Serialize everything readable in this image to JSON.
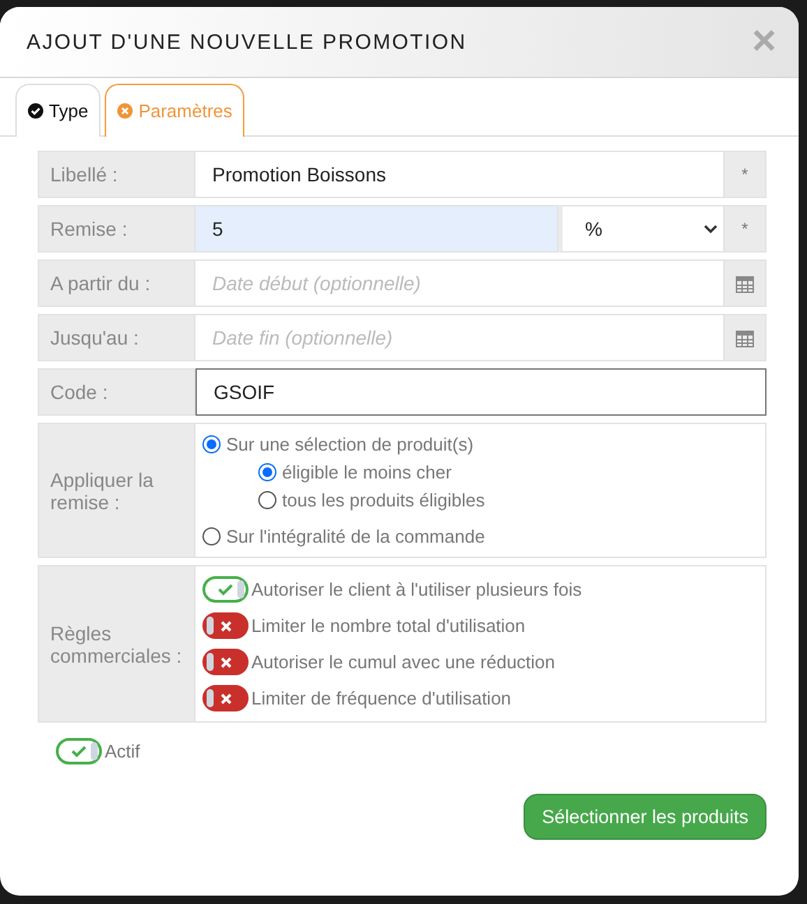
{
  "dialog": {
    "title": "AJOUT D'UNE NOUVELLE PROMOTION",
    "close": "×"
  },
  "tabs": [
    {
      "label": "Type",
      "kind": "done",
      "selected": false
    },
    {
      "label": "Paramètres",
      "kind": "error",
      "selected": true
    }
  ],
  "fields": [
    {
      "label": "Libellé :",
      "kind": "text",
      "value": "Promotion Boissons",
      "required": "*"
    },
    {
      "label": "Remise :",
      "kind": "amount",
      "value": "5",
      "unit": "%",
      "highlighted": true,
      "required": "*"
    },
    {
      "label": "A partir du :",
      "kind": "date",
      "placeholder": "Date début (optionnelle)"
    },
    {
      "label": "Jusqu'au :",
      "kind": "date",
      "placeholder": "Date fin (optionnelle)"
    },
    {
      "label": "Code :",
      "kind": "text",
      "value": "GSOIF",
      "focused": true
    }
  ],
  "apply": {
    "label": "Appliquer la remise :",
    "options": [
      {
        "label": "Sur une sélection de produit(s)",
        "selected": true,
        "children": [
          {
            "label": "éligible le moins cher",
            "selected": true
          },
          {
            "label": "tous les produits éligibles",
            "selected": false
          }
        ]
      },
      {
        "label": "Sur l'intégralité de la commande",
        "selected": false
      }
    ]
  },
  "rules": {
    "label": "Règles commerciales :",
    "items": [
      {
        "label": "Autoriser le client à l'utiliser plusieurs fois",
        "on": true
      },
      {
        "label": "Limiter le nombre total d'utilisation",
        "on": false
      },
      {
        "label": "Autoriser le cumul avec une réduction",
        "on": false
      },
      {
        "label": "Limiter de fréquence d'utilisation",
        "on": false
      }
    ]
  },
  "active": {
    "label": "Actif",
    "on": true
  },
  "button": "Sélectionner les produits"
}
